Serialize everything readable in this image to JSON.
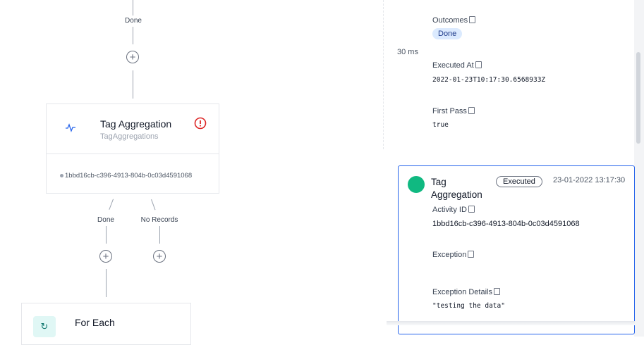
{
  "workflow": {
    "top_connector_label": "Done",
    "activity": {
      "title": "Tag Aggregation",
      "subtitle": "TagAggregations",
      "id": "1bbd16cb-c396-4913-804b-0c03d4591068",
      "icon": "activity-pulse-icon",
      "status_icon": "error-circle-icon"
    },
    "outcomes": [
      {
        "label": "Done"
      },
      {
        "label": "No Records"
      }
    ],
    "next_activity": {
      "title": "For Each",
      "icon": "loop-arrow-icon"
    }
  },
  "details": {
    "duration": "30 ms",
    "outcomes_label": "Outcomes",
    "outcomes_value": "Done",
    "executed_at_label": "Executed At",
    "executed_at_value": "2022-01-23T10:17:30.6568933Z",
    "first_pass_label": "First Pass",
    "first_pass_value": "true"
  },
  "execution_card": {
    "name": "Tag Aggregation",
    "status": "Executed",
    "timestamp": "23-01-2022 13:17:30",
    "status_color": "#10b981",
    "activity_id_label": "Activity ID",
    "activity_id": "1bbd16cb-c396-4913-804b-0c03d4591068",
    "exception_label": "Exception",
    "exception_details_label": "Exception Details",
    "exception_details_value": "\"testing the data\""
  },
  "colors": {
    "accent": "#2563eb",
    "success": "#10b981",
    "error": "#dc2626",
    "badge_bg": "#dbeafe"
  }
}
